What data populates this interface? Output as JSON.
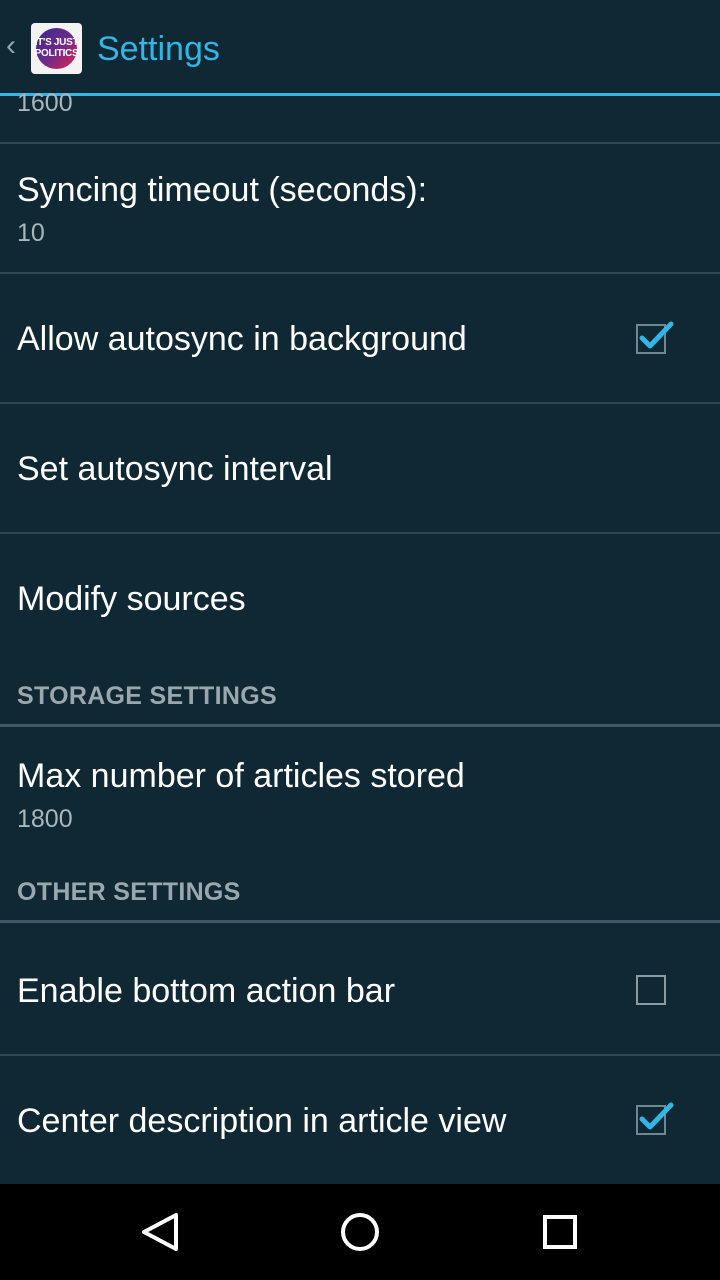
{
  "header": {
    "back_icon": "chevron-left-icon",
    "logo_text_line1": "IT'S JUST",
    "logo_text_line2": "POLITICS",
    "title": "Settings",
    "accent_color": "#33b5e5"
  },
  "preferences": {
    "partial_top_value": "1600",
    "sync_timeout": {
      "title": "Syncing timeout (seconds):",
      "summary": "10"
    },
    "autosync_background": {
      "title": "Allow autosync in background",
      "checked": true
    },
    "autosync_interval": {
      "title": "Set autosync interval"
    },
    "modify_sources": {
      "title": "Modify sources"
    },
    "storage_category": "STORAGE SETTINGS",
    "max_articles": {
      "title": "Max number of articles stored",
      "summary": "1800"
    },
    "other_category": "OTHER SETTINGS",
    "bottom_action_bar": {
      "title": "Enable bottom action bar",
      "checked": false
    },
    "center_description": {
      "title": "Center description in article view",
      "checked": true
    }
  },
  "nav": {
    "back_icon": "triangle-back-icon",
    "home_icon": "circle-home-icon",
    "recents_icon": "square-recents-icon"
  }
}
